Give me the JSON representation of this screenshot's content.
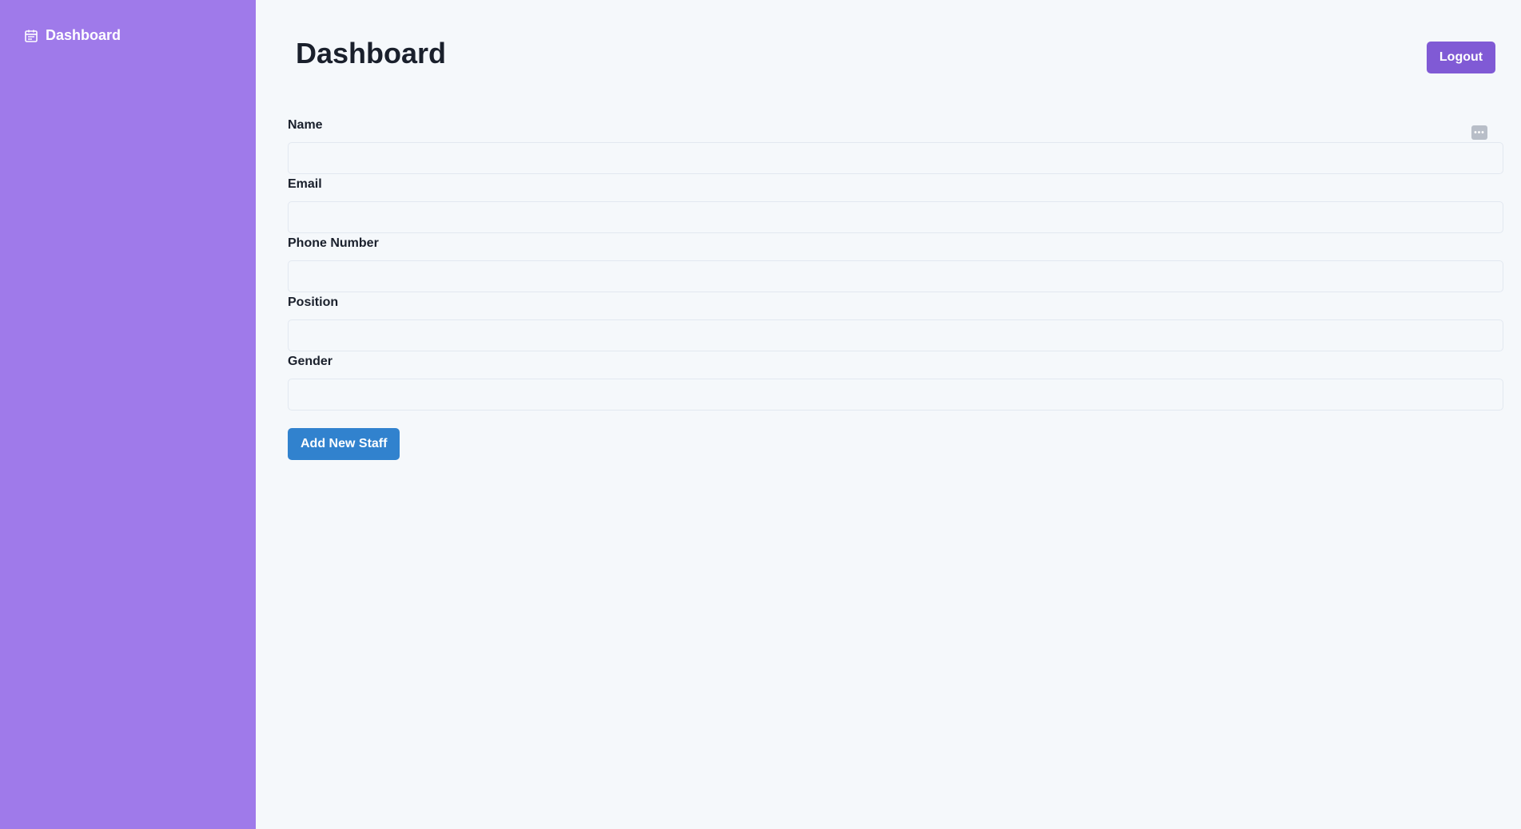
{
  "sidebar": {
    "items": [
      {
        "label": "Dashboard",
        "icon": "calendar-icon"
      }
    ]
  },
  "header": {
    "title": "Dashboard",
    "logout_label": "Logout"
  },
  "form": {
    "fields": [
      {
        "label": "Name",
        "value": ""
      },
      {
        "label": "Email",
        "value": ""
      },
      {
        "label": "Phone Number",
        "value": ""
      },
      {
        "label": "Position",
        "value": ""
      },
      {
        "label": "Gender",
        "value": ""
      }
    ],
    "submit_label": "Add New Staff"
  },
  "colors": {
    "sidebar_bg": "#9f7aea",
    "logout_bg": "#805ad5",
    "submit_bg": "#3182ce",
    "page_bg": "#f5f8fb"
  }
}
